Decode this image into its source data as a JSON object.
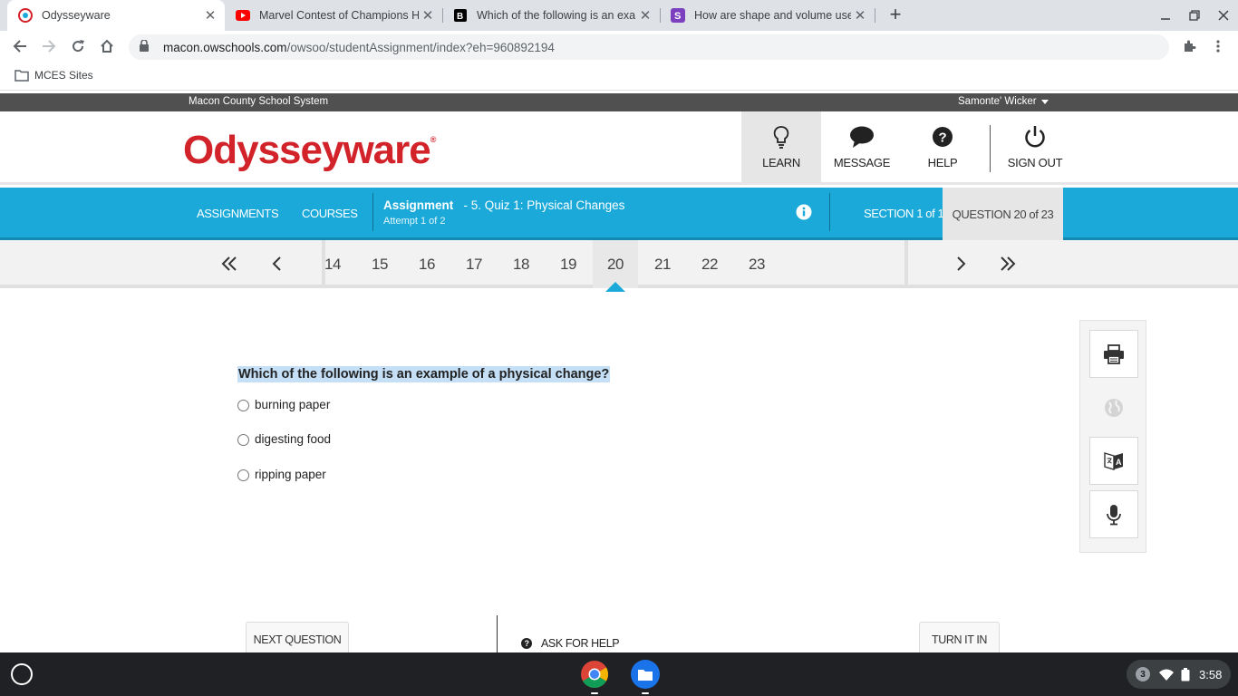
{
  "browser": {
    "tabs": [
      {
        "title": "Odysseyware",
        "icon": "odysseyware-favicon",
        "active": true
      },
      {
        "title": "Marvel Contest of Champions H",
        "icon": "youtube-favicon",
        "active": false
      },
      {
        "title": "Which of the following is an exa",
        "icon": "brainly-favicon",
        "active": false
      },
      {
        "title": "How are shape and volume usec",
        "icon": "quizlet-favicon",
        "active": false
      }
    ],
    "url_host": "macon.owschools.com",
    "url_path": "/owsoo/studentAssignment/index?eh=960892194",
    "bookmark": "MCES Sites"
  },
  "header": {
    "district": "Macon County School System",
    "user": "Samonte' Wicker",
    "logo": "Odysseyware",
    "nav": {
      "learn": "LEARN",
      "message": "MESSAGE",
      "help": "HELP",
      "signout": "SIGN OUT"
    }
  },
  "assignment_bar": {
    "assignments": "ASSIGNMENTS",
    "courses": "COURSES",
    "assignment_label": "Assignment",
    "assignment_name": "- 5. Quiz 1: Physical Changes",
    "attempt": "Attempt 1 of 2",
    "section": "SECTION 1 of 1",
    "question": "QUESTION 20 of 23"
  },
  "question_nav": {
    "numbers": [
      "14",
      "15",
      "16",
      "17",
      "18",
      "19",
      "20",
      "21",
      "22",
      "23"
    ],
    "current": "20"
  },
  "question": {
    "text": "Which of the following is an example of a physical change?",
    "choices": [
      "burning paper",
      "digesting food",
      "ripping paper"
    ]
  },
  "footer": {
    "next": "NEXT QUESTION",
    "ask_help": "ASK FOR HELP",
    "turn_in": "TURN IT IN"
  },
  "shelf": {
    "notifications": "3",
    "time": "3:58"
  },
  "colors": {
    "brand_red": "#d2232a",
    "accent_blue": "#1aa9d8",
    "dark_bar": "#505050"
  }
}
